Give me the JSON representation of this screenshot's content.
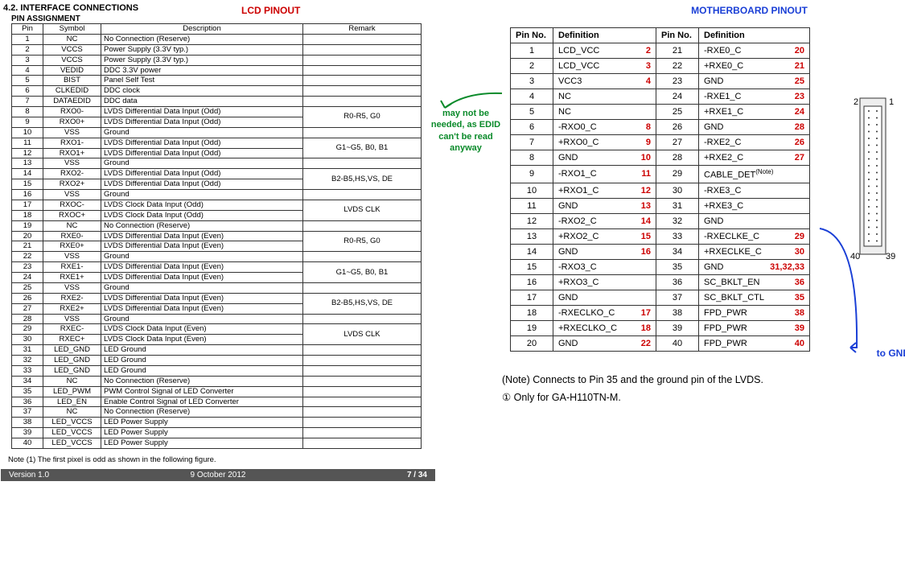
{
  "section": "4.2. INTERFACE CONNECTIONS",
  "lcd_title": "LCD PINOUT",
  "mb_title": "MOTHERBOARD PINOUT",
  "pin_assignment": "PIN ASSIGNMENT",
  "lcd_headers": {
    "pin": "Pin",
    "symbol": "Symbol",
    "desc": "Description",
    "remark": "Remark"
  },
  "lcd_rows": [
    {
      "pin": "1",
      "sym": "NC",
      "desc": "No Connection (Reserve)",
      "rem": ""
    },
    {
      "pin": "2",
      "sym": "VCCS",
      "desc": "Power Supply (3.3V typ.)",
      "rem": ""
    },
    {
      "pin": "3",
      "sym": "VCCS",
      "desc": "Power Supply (3.3V typ.)",
      "rem": ""
    },
    {
      "pin": "4",
      "sym": "VEDID",
      "desc": "DDC 3.3V power",
      "rem": ""
    },
    {
      "pin": "5",
      "sym": "BIST",
      "desc": "Panel Self Test",
      "rem": ""
    },
    {
      "pin": "6",
      "sym": "CLKEDID",
      "desc": "DDC clock",
      "rem": ""
    },
    {
      "pin": "7",
      "sym": "DATAEDID",
      "desc": "DDC data",
      "rem": ""
    },
    {
      "pin": "8",
      "sym": "RXO0-",
      "desc": "LVDS Differential Data Input (Odd)",
      "rem": "R0-R5, G0",
      "span": 2
    },
    {
      "pin": "9",
      "sym": "RXO0+",
      "desc": "LVDS Differential Data Input (Odd)"
    },
    {
      "pin": "10",
      "sym": "VSS",
      "desc": "Ground",
      "rem": ""
    },
    {
      "pin": "11",
      "sym": "RXO1-",
      "desc": "LVDS Differential Data Input (Odd)",
      "rem": "G1~G5, B0, B1",
      "span": 2
    },
    {
      "pin": "12",
      "sym": "RXO1+",
      "desc": "LVDS Differential Data Input (Odd)"
    },
    {
      "pin": "13",
      "sym": "VSS",
      "desc": "Ground",
      "rem": ""
    },
    {
      "pin": "14",
      "sym": "RXO2-",
      "desc": "LVDS Differential Data Input (Odd)",
      "rem": "B2-B5,HS,VS, DE",
      "span": 2
    },
    {
      "pin": "15",
      "sym": "RXO2+",
      "desc": "LVDS Differential Data Input (Odd)"
    },
    {
      "pin": "16",
      "sym": "VSS",
      "desc": "Ground",
      "rem": ""
    },
    {
      "pin": "17",
      "sym": "RXOC-",
      "desc": "LVDS Clock Data Input (Odd)",
      "rem": "LVDS CLK",
      "span": 2
    },
    {
      "pin": "18",
      "sym": "RXOC+",
      "desc": "LVDS Clock Data Input (Odd)"
    },
    {
      "pin": "19",
      "sym": "NC",
      "desc": "No Connection (Reserve)",
      "rem": ""
    },
    {
      "pin": "20",
      "sym": "RXE0-",
      "desc": "LVDS Differential Data Input (Even)",
      "rem": "R0-R5, G0",
      "span": 2
    },
    {
      "pin": "21",
      "sym": "RXE0+",
      "desc": "LVDS Differential Data Input (Even)"
    },
    {
      "pin": "22",
      "sym": "VSS",
      "desc": "Ground",
      "rem": ""
    },
    {
      "pin": "23",
      "sym": "RXE1-",
      "desc": "LVDS Differential Data Input (Even)",
      "rem": "G1~G5, B0, B1",
      "span": 2
    },
    {
      "pin": "24",
      "sym": "RXE1+",
      "desc": "LVDS Differential Data Input (Even)"
    },
    {
      "pin": "25",
      "sym": "VSS",
      "desc": "Ground",
      "rem": ""
    },
    {
      "pin": "26",
      "sym": "RXE2-",
      "desc": "LVDS Differential Data Input (Even)",
      "rem": "B2-B5,HS,VS, DE",
      "span": 2
    },
    {
      "pin": "27",
      "sym": "RXE2+",
      "desc": "LVDS Differential Data Input (Even)"
    },
    {
      "pin": "28",
      "sym": "VSS",
      "desc": "Ground",
      "rem": ""
    },
    {
      "pin": "29",
      "sym": "RXEC-",
      "desc": "LVDS Clock Data Input (Even)",
      "rem": "LVDS CLK",
      "span": 2
    },
    {
      "pin": "30",
      "sym": "RXEC+",
      "desc": "LVDS Clock Data Input (Even)"
    },
    {
      "pin": "31",
      "sym": "LED_GND",
      "desc": "LED Ground",
      "rem": ""
    },
    {
      "pin": "32",
      "sym": "LED_GND",
      "desc": "LED Ground",
      "rem": ""
    },
    {
      "pin": "33",
      "sym": "LED_GND",
      "desc": "LED Ground",
      "rem": ""
    },
    {
      "pin": "34",
      "sym": "NC",
      "desc": "No Connection (Reserve)",
      "rem": ""
    },
    {
      "pin": "35",
      "sym": "LED_PWM",
      "desc": "PWM Control Signal of LED Converter",
      "rem": ""
    },
    {
      "pin": "36",
      "sym": "LED_EN",
      "desc": "Enable Control Signal of LED Converter",
      "rem": ""
    },
    {
      "pin": "37",
      "sym": "NC",
      "desc": "No Connection (Reserve)",
      "rem": ""
    },
    {
      "pin": "38",
      "sym": "LED_VCCS",
      "desc": "LED Power Supply",
      "rem": ""
    },
    {
      "pin": "39",
      "sym": "LED_VCCS",
      "desc": "LED Power Supply",
      "rem": ""
    },
    {
      "pin": "40",
      "sym": "LED_VCCS",
      "desc": "LED Power Supply",
      "rem": ""
    }
  ],
  "mb_headers": {
    "pin": "Pin No.",
    "def": "Definition"
  },
  "mb_left": [
    {
      "pin": "1",
      "def": "LCD_VCC",
      "red": "2"
    },
    {
      "pin": "2",
      "def": "LCD_VCC",
      "red": "3"
    },
    {
      "pin": "3",
      "def": "VCC3",
      "red": "4"
    },
    {
      "pin": "4",
      "def": "NC",
      "red": ""
    },
    {
      "pin": "5",
      "def": "NC",
      "red": ""
    },
    {
      "pin": "6",
      "def": "-RXO0_C",
      "red": "8"
    },
    {
      "pin": "7",
      "def": "+RXO0_C",
      "red": "9"
    },
    {
      "pin": "8",
      "def": "GND",
      "red": "10"
    },
    {
      "pin": "9",
      "def": "-RXO1_C",
      "red": "11"
    },
    {
      "pin": "10",
      "def": "+RXO1_C",
      "red": "12"
    },
    {
      "pin": "11",
      "def": "GND",
      "red": "13"
    },
    {
      "pin": "12",
      "def": "-RXO2_C",
      "red": "14"
    },
    {
      "pin": "13",
      "def": "+RXO2_C",
      "red": "15"
    },
    {
      "pin": "14",
      "def": "GND",
      "red": "16"
    },
    {
      "pin": "15",
      "def": "-RXO3_C",
      "red": ""
    },
    {
      "pin": "16",
      "def": "+RXO3_C",
      "red": ""
    },
    {
      "pin": "17",
      "def": "GND",
      "red": ""
    },
    {
      "pin": "18",
      "def": "-RXECLKO_C",
      "red": "17"
    },
    {
      "pin": "19",
      "def": "+RXECLKO_C",
      "red": "18"
    },
    {
      "pin": "20",
      "def": "GND",
      "red": "22"
    }
  ],
  "mb_right": [
    {
      "pin": "21",
      "def": "-RXE0_C",
      "red": "20"
    },
    {
      "pin": "22",
      "def": "+RXE0_C",
      "red": "21"
    },
    {
      "pin": "23",
      "def": "GND",
      "red": "25"
    },
    {
      "pin": "24",
      "def": "-RXE1_C",
      "red": "23"
    },
    {
      "pin": "25",
      "def": "+RXE1_C",
      "red": "24"
    },
    {
      "pin": "26",
      "def": "GND",
      "red": "28"
    },
    {
      "pin": "27",
      "def": "-RXE2_C",
      "red": "26"
    },
    {
      "pin": "28",
      "def": "+RXE2_C",
      "red": "27"
    },
    {
      "pin": "29",
      "def": "CABLE_DET",
      "red": "",
      "sup": "(Note)"
    },
    {
      "pin": "30",
      "def": "-RXE3_C",
      "red": ""
    },
    {
      "pin": "31",
      "def": "+RXE3_C",
      "red": ""
    },
    {
      "pin": "32",
      "def": "GND",
      "red": ""
    },
    {
      "pin": "33",
      "def": "-RXECLKE_C",
      "red": "29"
    },
    {
      "pin": "34",
      "def": "+RXECLKE_C",
      "red": "30"
    },
    {
      "pin": "35",
      "def": "GND",
      "red": "31,32,33"
    },
    {
      "pin": "36",
      "def": "SC_BKLT_EN",
      "red": "36"
    },
    {
      "pin": "37",
      "def": "SC_BKLT_CTL",
      "red": "35"
    },
    {
      "pin": "38",
      "def": "FPD_PWR",
      "red": "38"
    },
    {
      "pin": "39",
      "def": "FPD_PWR",
      "red": "39"
    },
    {
      "pin": "40",
      "def": "FPD_PWR",
      "red": "40"
    }
  ],
  "green_note": "may not be needed, as EDID can't be read anyway",
  "gnd_note": "to GND",
  "note1": "Note (1)  The first pixel is odd as shown in the following figure.",
  "mb_note": "(Note)     Connects to Pin 35 and the ground pin of the LVDS.",
  "mb_note2": "①   Only for GA-H110TN-M.",
  "footer": {
    "v": "Version 1.0",
    "d": "9 October 2012",
    "p": "7 / 34"
  },
  "conn": {
    "p1": "1",
    "p2": "2",
    "p39": "39",
    "p40": "40"
  }
}
